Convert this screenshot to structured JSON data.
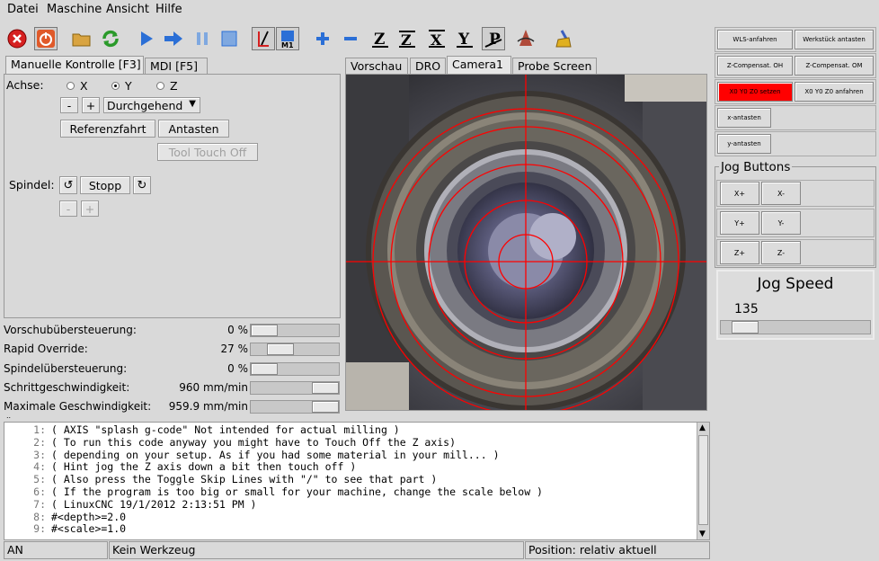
{
  "menu": [
    "Datei",
    "Maschine",
    "Ansicht",
    "Hilfe"
  ],
  "left_tabs": [
    "Manuelle Kontrolle [F3]",
    "MDI [F5]"
  ],
  "view_tabs": [
    "Vorschau",
    "DRO",
    "Camera1",
    "Probe Screen"
  ],
  "manual": {
    "axis_label": "Achse:",
    "axes": [
      "X",
      "Y",
      "Z"
    ],
    "selected_axis": "Y",
    "minus": "-",
    "plus": "+",
    "jog_mode": "Durchgehend",
    "home_button": "Referenzfahrt",
    "touch_button": "Antasten",
    "tool_touch_off": "Tool Touch Off",
    "spindle_label": "Spindel:",
    "spindle_stop": "Stopp",
    "spindle_minus": "-",
    "spindle_plus": "+"
  },
  "overrides": [
    {
      "label": "Vorschubübersteuerung:",
      "value": "0 %",
      "fraction": 0.0
    },
    {
      "label": "Rapid Override:",
      "value": "27 %",
      "fraction": 0.27
    },
    {
      "label": "Spindelübersteuerung:",
      "value": "0 %",
      "fraction": 0.0
    },
    {
      "label": "Schrittgeschwindigkeit:",
      "value": "960 mm/min",
      "fraction": 1.0
    },
    {
      "label": "Maximale Geschwindigkeit:",
      "value": "959.9 mm/min",
      "fraction": 1.0
    }
  ],
  "right_panel": {
    "buttons": [
      [
        "WLS-anfahren",
        "Werkstück antasten"
      ],
      [
        "Z-Compensat. OH",
        "Z-Compensat. OM"
      ],
      [
        "X0 Y0 Z0 setzen",
        "X0 Y0 Z0 anfahren"
      ]
    ],
    "x_probe": "x-antasten",
    "y_probe": "y-antasten",
    "jog_title": "Jog Buttons",
    "jog": [
      [
        "X+",
        "X-"
      ],
      [
        "Y+",
        "Y-"
      ],
      [
        "Z+",
        "Z-"
      ]
    ],
    "jog_speed_title": "Jog Speed",
    "jog_speed_value": "135",
    "highlight_color": "#ff0000"
  },
  "gcode": [
    {
      "n": "1:",
      "text": "( AXIS \"splash g-code\" Not intended for actual milling )"
    },
    {
      "n": "2:",
      "text": "( To run this code anyway you might have to Touch Off the Z axis)"
    },
    {
      "n": "3:",
      "text": "( depending on your setup. As if you had some material in your mill... )"
    },
    {
      "n": "4:",
      "text": "( Hint jog the Z axis down a bit then touch off )"
    },
    {
      "n": "5:",
      "text": "( Also press the Toggle Skip Lines with \"/\" to see that part )"
    },
    {
      "n": "6:",
      "text": "( If the program is too big or small for your machine, change the scale below )"
    },
    {
      "n": "7:",
      "text": "( LinuxCNC 19/1/2012 2:13:51 PM )"
    },
    {
      "n": "8:",
      "text": "#<depth>=2.0"
    },
    {
      "n": "9:",
      "text": "#<scale>=1.0"
    }
  ],
  "status": {
    "machine": "AN",
    "tool": "Kein Werkzeug",
    "position": "Position: relativ aktuell"
  }
}
